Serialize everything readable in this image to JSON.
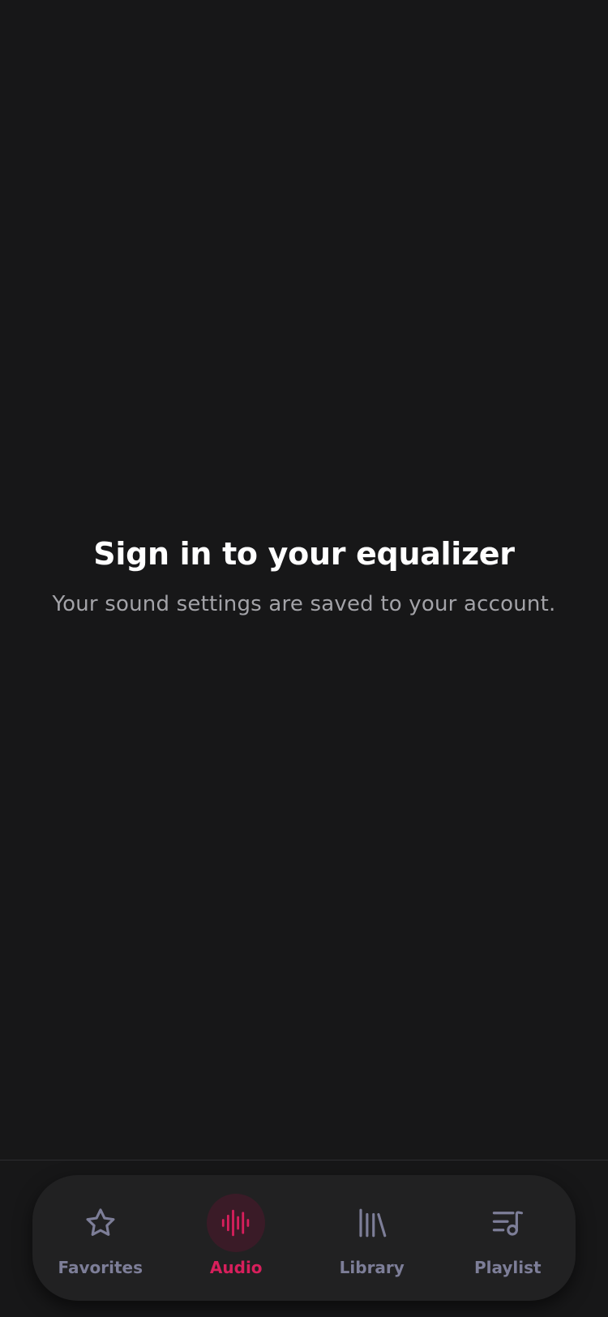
{
  "empty_state": {
    "title": "Sign in to your equalizer",
    "subtitle": "Your sound settings are saved to your account."
  },
  "tabbar": {
    "active": "audio",
    "tabs": [
      {
        "id": "favorites",
        "label": "Favorites",
        "icon": "star-icon"
      },
      {
        "id": "audio",
        "label": "Audio",
        "icon": "waveform-icon"
      },
      {
        "id": "library",
        "label": "Library",
        "icon": "library-icon"
      },
      {
        "id": "playlist",
        "label": "Playlist",
        "icon": "playlist-icon"
      }
    ]
  },
  "colors": {
    "background": "#171718",
    "tabbar": "#212122",
    "accent": "#d71f5c",
    "accent_bg": "#3a1b27",
    "inactive": "#7d7e98",
    "title": "#ffffff",
    "subtitle": "#a3a3a8"
  }
}
